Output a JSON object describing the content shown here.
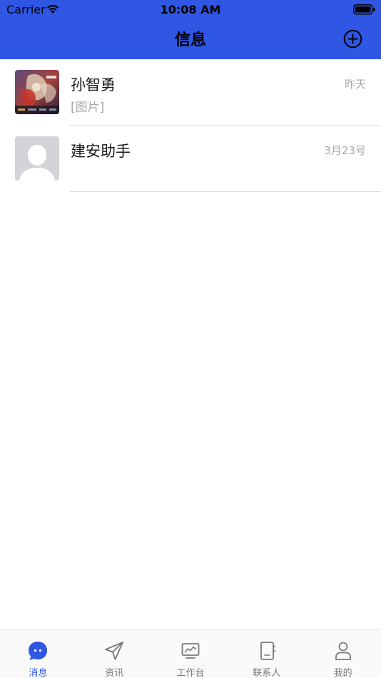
{
  "status_bar": {
    "carrier": "Carrier",
    "time": "10:08 AM"
  },
  "nav": {
    "title": "信息",
    "add_icon": "plus-circle-icon"
  },
  "conversations": [
    {
      "name": "孙智勇",
      "preview": "[图片]",
      "time": "昨天",
      "avatar": "photo-avatar"
    },
    {
      "name": "建安助手",
      "preview": "",
      "time": "3月23号",
      "avatar": "default-avatar"
    }
  ],
  "tabs": [
    {
      "label": "消息",
      "icon": "chat-bubble-icon",
      "active": true
    },
    {
      "label": "资讯",
      "icon": "paper-plane-icon",
      "active": false
    },
    {
      "label": "工作台",
      "icon": "monitor-chart-icon",
      "active": false
    },
    {
      "label": "联系人",
      "icon": "address-book-icon",
      "active": false
    },
    {
      "label": "我的",
      "icon": "person-icon",
      "active": false
    }
  ],
  "colors": {
    "primary": "#2f57e4",
    "secondary_text": "#a8a8a8",
    "inactive_tab": "#7a7a7a"
  }
}
